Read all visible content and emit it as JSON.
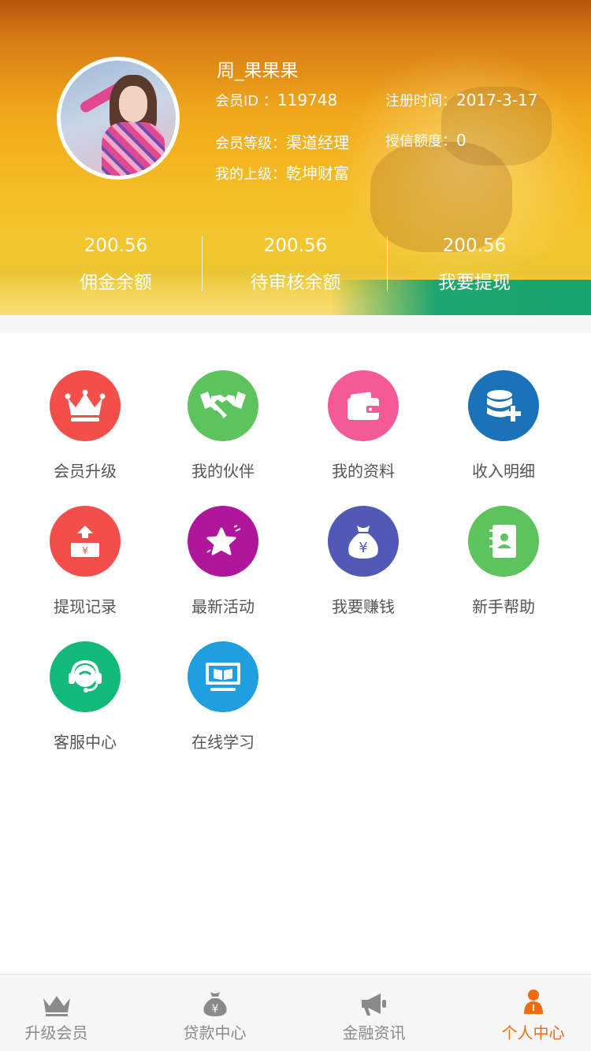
{
  "profile": {
    "name": "周_果果果",
    "member_id_label": "会员ID ：",
    "member_id": "119748",
    "register_label": "注册时间：",
    "register_date": "2017-3-17",
    "level_label": "会员等级：",
    "level": "渠道经理",
    "credit_label": "授信额度：",
    "credit": "0",
    "superior_label": "我的上级：",
    "superior": "乾坤财富"
  },
  "stats": [
    {
      "value": "200.56",
      "label": "佣金余额"
    },
    {
      "value": "200.56",
      "label": "待审核余额"
    },
    {
      "value": "200.56",
      "label": "我要提现"
    }
  ],
  "menu": [
    {
      "label": "会员升级",
      "icon": "crown-icon",
      "color": "#f24f4a"
    },
    {
      "label": "我的伙伴",
      "icon": "handshake-icon",
      "color": "#5cc35d"
    },
    {
      "label": "我的资料",
      "icon": "wallet-icon",
      "color": "#f55a98"
    },
    {
      "label": "收入明细",
      "icon": "coins-plus-icon",
      "color": "#1a73b8"
    },
    {
      "label": "提现记录",
      "icon": "withdraw-icon",
      "color": "#f24f4a"
    },
    {
      "label": "最新活动",
      "icon": "star-icon",
      "color": "#b0169b"
    },
    {
      "label": "我要赚钱",
      "icon": "money-bag-icon",
      "color": "#5258b5"
    },
    {
      "label": "新手帮助",
      "icon": "contact-book-icon",
      "color": "#5cc35d"
    },
    {
      "label": "客服中心",
      "icon": "headset-icon",
      "color": "#13b97a"
    },
    {
      "label": "在线学习",
      "icon": "monitor-book-icon",
      "color": "#1f9ee0"
    }
  ],
  "tabs": [
    {
      "label": "升级会员",
      "icon": "crown-icon",
      "active": false
    },
    {
      "label": "贷款中心",
      "icon": "money-bag-icon",
      "active": false
    },
    {
      "label": "金融资讯",
      "icon": "megaphone-icon",
      "active": false
    },
    {
      "label": "个人中心",
      "icon": "person-icon",
      "active": true
    }
  ],
  "colors": {
    "accent": "#f26b0f",
    "tab_inactive": "#8a8a8a"
  }
}
